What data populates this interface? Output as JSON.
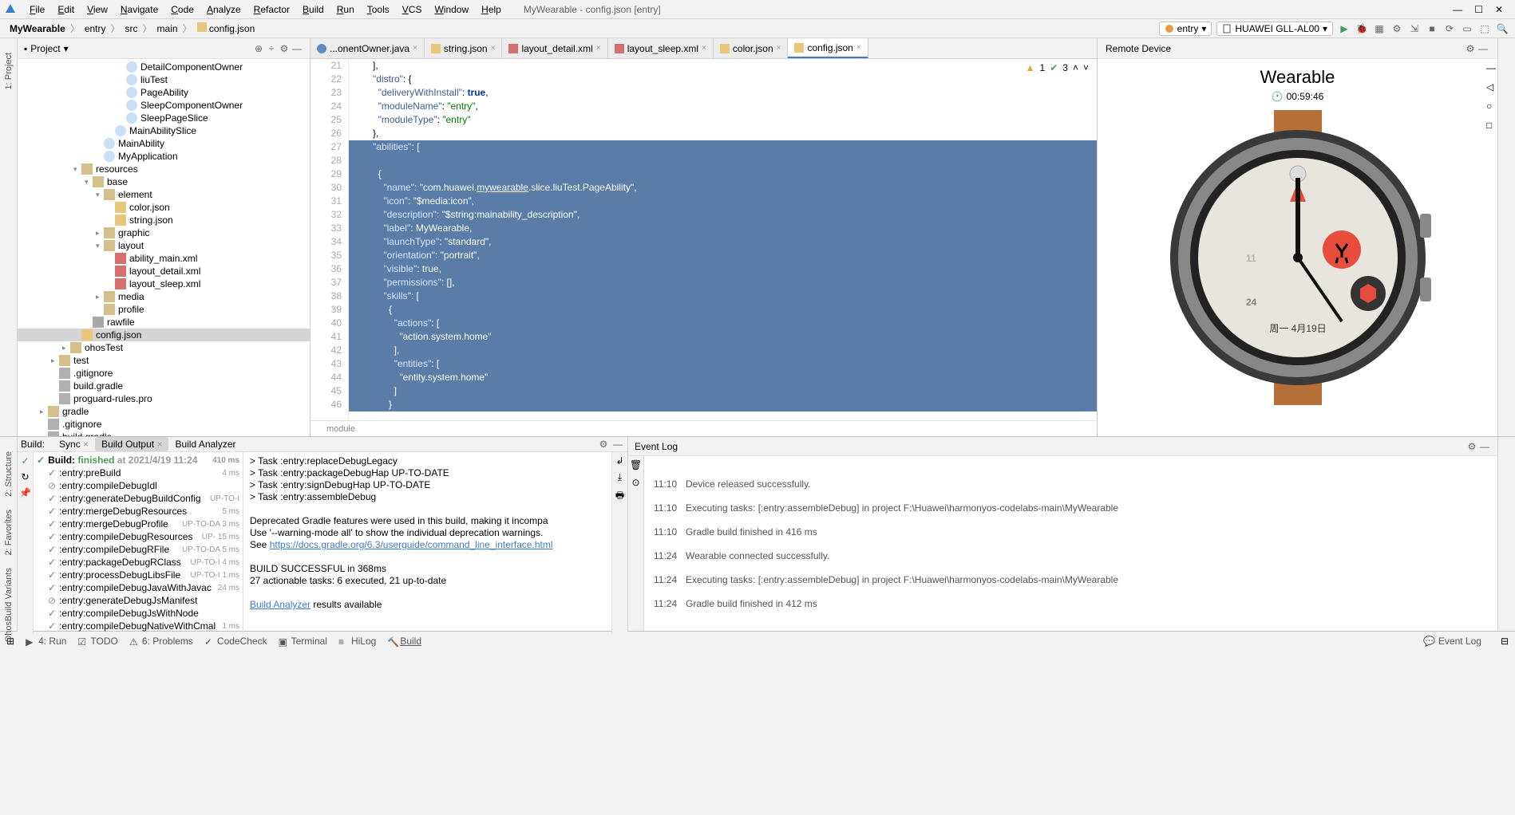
{
  "window_title": "MyWearable - config.json [entry]",
  "menu": [
    "File",
    "Edit",
    "View",
    "Navigate",
    "Code",
    "Analyze",
    "Refactor",
    "Build",
    "Run",
    "Tools",
    "VCS",
    "Window",
    "Help"
  ],
  "breadcrumb": [
    "MyWearable",
    "entry",
    "src",
    "main",
    "config.json"
  ],
  "run_config": "entry",
  "device_selector": "HUAWEI GLL-AL00",
  "project_panel_title": "Project",
  "tree": [
    {
      "d": 9,
      "ic": "class",
      "t": "DetailComponentOwner"
    },
    {
      "d": 9,
      "ic": "class",
      "t": "liuTest"
    },
    {
      "d": 9,
      "ic": "class",
      "t": "PageAbility"
    },
    {
      "d": 9,
      "ic": "class",
      "t": "SleepComponentOwner"
    },
    {
      "d": 9,
      "ic": "class",
      "t": "SleepPageSlice"
    },
    {
      "d": 8,
      "ic": "class",
      "t": "MainAbilitySlice"
    },
    {
      "d": 7,
      "ic": "class",
      "t": "MainAbility"
    },
    {
      "d": 7,
      "ic": "class",
      "t": "MyApplication"
    },
    {
      "d": 5,
      "ic": "folder",
      "t": "resources",
      "chev": "v"
    },
    {
      "d": 6,
      "ic": "folder",
      "t": "base",
      "chev": "v"
    },
    {
      "d": 7,
      "ic": "folder",
      "t": "element",
      "chev": "v"
    },
    {
      "d": 8,
      "ic": "json",
      "t": "color.json"
    },
    {
      "d": 8,
      "ic": "json",
      "t": "string.json"
    },
    {
      "d": 7,
      "ic": "folder",
      "t": "graphic",
      "chev": ">"
    },
    {
      "d": 7,
      "ic": "folder",
      "t": "layout",
      "chev": "v"
    },
    {
      "d": 8,
      "ic": "xml",
      "t": "ability_main.xml"
    },
    {
      "d": 8,
      "ic": "xml",
      "t": "layout_detail.xml"
    },
    {
      "d": 8,
      "ic": "xml",
      "t": "layout_sleep.xml"
    },
    {
      "d": 7,
      "ic": "folder",
      "t": "media",
      "chev": ">"
    },
    {
      "d": 7,
      "ic": "folder",
      "t": "profile"
    },
    {
      "d": 6,
      "ic": "folder-o",
      "t": "rawfile"
    },
    {
      "d": 5,
      "ic": "json",
      "t": "config.json",
      "sel": true
    },
    {
      "d": 4,
      "ic": "folder",
      "t": "ohosTest",
      "chev": ">"
    },
    {
      "d": 3,
      "ic": "folder",
      "t": "test",
      "chev": ">"
    },
    {
      "d": 3,
      "ic": "file",
      "t": ".gitignore"
    },
    {
      "d": 3,
      "ic": "file",
      "t": "build.gradle"
    },
    {
      "d": 3,
      "ic": "file",
      "t": "proguard-rules.pro"
    },
    {
      "d": 2,
      "ic": "folder",
      "t": "gradle",
      "chev": ">"
    },
    {
      "d": 2,
      "ic": "file",
      "t": ".gitignore"
    },
    {
      "d": 2,
      "ic": "file",
      "t": "build.gradle"
    }
  ],
  "editor_tabs": [
    {
      "ic": "java",
      "label": "...onentOwner.java",
      "active": false
    },
    {
      "ic": "json",
      "label": "string.json",
      "active": false
    },
    {
      "ic": "xml",
      "label": "layout_detail.xml",
      "active": false
    },
    {
      "ic": "xml",
      "label": "layout_sleep.xml",
      "active": false
    },
    {
      "ic": "json",
      "label": "color.json",
      "active": false
    },
    {
      "ic": "json",
      "label": "config.json",
      "active": true
    }
  ],
  "inspect": {
    "warn": "1",
    "check": "3"
  },
  "code_lines": [
    {
      "n": 21,
      "sel": false,
      "html": "      ],"
    },
    {
      "n": 22,
      "sel": false,
      "html": "      <span class='key'>\"distro\"</span>: {"
    },
    {
      "n": 23,
      "sel": false,
      "html": "        <span class='key'>\"deliveryWithInstall\"</span>: <span class='val'>true</span>,"
    },
    {
      "n": 24,
      "sel": false,
      "html": "        <span class='key'>\"moduleName\"</span>: <span class='str'>\"entry\"</span>,"
    },
    {
      "n": 25,
      "sel": false,
      "html": "        <span class='key'>\"moduleType\"</span>: <span class='str'>\"entry\"</span>"
    },
    {
      "n": 26,
      "sel": false,
      "html": "      },"
    },
    {
      "n": 27,
      "sel": true,
      "html": "      <span class='key'>\"abilities\"</span>: ["
    },
    {
      "n": 28,
      "sel": true,
      "html": ""
    },
    {
      "n": 29,
      "sel": true,
      "html": "        {"
    },
    {
      "n": 30,
      "sel": true,
      "html": "          <span class='key'>\"name\"</span>: <span class='str'>\"com.huawei.<u>mywearable</u>.slice.liuTest.PageAbility\"</span>,"
    },
    {
      "n": 31,
      "sel": true,
      "html": "          <span class='key'>\"icon\"</span>: <span class='str'>\"$media:icon\"</span>,"
    },
    {
      "n": 32,
      "sel": true,
      "html": "          <span class='key'>\"description\"</span>: <span class='str'>\"$string:mainability_description\"</span>,"
    },
    {
      "n": 33,
      "sel": true,
      "html": "          <span class='key'>\"label\"</span>: MyWearable,"
    },
    {
      "n": 34,
      "sel": true,
      "html": "          <span class='key'>\"launchType\"</span>: <span class='str'>\"standard\"</span>,"
    },
    {
      "n": 35,
      "sel": true,
      "html": "          <span class='key'>\"orientation\"</span>: <span class='str'>\"portrait\"</span>,"
    },
    {
      "n": 36,
      "sel": true,
      "html": "          <span class='key'>\"visible\"</span>: true,"
    },
    {
      "n": 37,
      "sel": true,
      "html": "          <span class='key'>\"permissions\"</span>: [],"
    },
    {
      "n": 38,
      "sel": true,
      "html": "          <span class='key'>\"skills\"</span>: ["
    },
    {
      "n": 39,
      "sel": true,
      "html": "            {"
    },
    {
      "n": 40,
      "sel": true,
      "html": "              <span class='key'>\"actions\"</span>: ["
    },
    {
      "n": 41,
      "sel": true,
      "html": "                <span class='str'>\"action.system.home\"</span>"
    },
    {
      "n": 42,
      "sel": true,
      "html": "              ],"
    },
    {
      "n": 43,
      "sel": true,
      "html": "              <span class='key'>\"entities\"</span>: ["
    },
    {
      "n": 44,
      "sel": true,
      "html": "                <span class='str'>\"entity.system.home\"</span>"
    },
    {
      "n": 45,
      "sel": true,
      "html": "              ]"
    },
    {
      "n": 46,
      "sel": true,
      "html": "            }"
    }
  ],
  "editor_status": "module",
  "remote_device_label": "Remote Device",
  "wearable_title": "Wearable",
  "wearable_time": "00:59:46",
  "watch_face": {
    "big1": "11",
    "big2": "24",
    "date": "周一 4月19日"
  },
  "build": {
    "label": "Build:",
    "tabs": [
      "Sync",
      "Build Output",
      "Build Analyzer"
    ],
    "active_tab": 1,
    "root": {
      "label": "Build:",
      "status": "finished",
      "at": "at 2021/4/19 11:24",
      "time": "410 ms"
    },
    "tasks": [
      {
        "s": "ok",
        "label": ":entry:preBuild",
        "time": "4 ms"
      },
      {
        "s": "sp",
        "label": ":entry:compileDebugIdl",
        "time": ""
      },
      {
        "s": "ok",
        "label": ":entry:generateDebugBuildConfig",
        "time": "UP-TO-I"
      },
      {
        "s": "ok",
        "label": ":entry:mergeDebugResources",
        "time": "5 ms"
      },
      {
        "s": "ok",
        "label": ":entry:mergeDebugProfile",
        "time": "UP-TO-DA 3 ms"
      },
      {
        "s": "ok",
        "label": ":entry:compileDebugResources",
        "time": "UP- 15 ms"
      },
      {
        "s": "ok",
        "label": ":entry:compileDebugRFile",
        "time": "UP-TO-DA 5 ms"
      },
      {
        "s": "ok",
        "label": ":entry:packageDebugRClass",
        "time": "UP-TO-I 4 ms"
      },
      {
        "s": "ok",
        "label": ":entry:processDebugLibsFile",
        "time": "UP-TO-I 1 ms"
      },
      {
        "s": "ok",
        "label": ":entry:compileDebugJavaWithJavac",
        "time": "24 ms"
      },
      {
        "s": "sp",
        "label": ":entry:generateDebugJsManifest",
        "time": ""
      },
      {
        "s": "ok",
        "label": ":entry:compileDebugJsWithNode",
        "time": ""
      },
      {
        "s": "ok",
        "label": ":entry:compileDebugNativeWithCmal",
        "time": "1 ms"
      }
    ],
    "output": [
      "> Task :entry:replaceDebugLegacy",
      "> Task :entry:packageDebugHap UP-TO-DATE",
      "> Task :entry:signDebugHap UP-TO-DATE",
      "> Task :entry:assembleDebug",
      "",
      "Deprecated Gradle features were used in this build, making it incompa",
      "Use '--warning-mode all' to show the individual deprecation warnings.",
      "See <a>https://docs.gradle.org/6.3/userguide/command_line_interface.html</a>",
      "",
      "BUILD SUCCESSFUL in 368ms",
      "27 actionable tasks: 6 executed, 21 up-to-date",
      "",
      "<a>Build Analyzer</a> results available"
    ]
  },
  "event_log": {
    "title": "Event Log",
    "rows": [
      {
        "t": "",
        "msg": ""
      },
      {
        "t": "11:10",
        "msg": "Device released successfully."
      },
      {
        "t": "11:10",
        "msg": "Executing tasks: [:entry:assembleDebug] in project F:\\Huawei\\harmonyos-codelabs-main\\MyWearable"
      },
      {
        "t": "11:10",
        "msg": "Gradle build finished in 416 ms"
      },
      {
        "t": "11:24",
        "msg": "Wearable connected successfully."
      },
      {
        "t": "11:24",
        "msg": "Executing tasks: [:entry:assembleDebug] in project F:\\Huawei\\harmonyos-codelabs-main\\MyWearable"
      },
      {
        "t": "11:24",
        "msg": "Gradle build finished in 412 ms"
      }
    ]
  },
  "status_bar": {
    "items": [
      "4: Run",
      "TODO",
      "6: Problems",
      "CodeCheck",
      "Terminal",
      "HiLog",
      "Build"
    ],
    "right": "Event Log"
  },
  "left_tabs": [
    "1: Project",
    "2: Structure",
    "2: Favorites",
    "OhosBuild Variants"
  ]
}
